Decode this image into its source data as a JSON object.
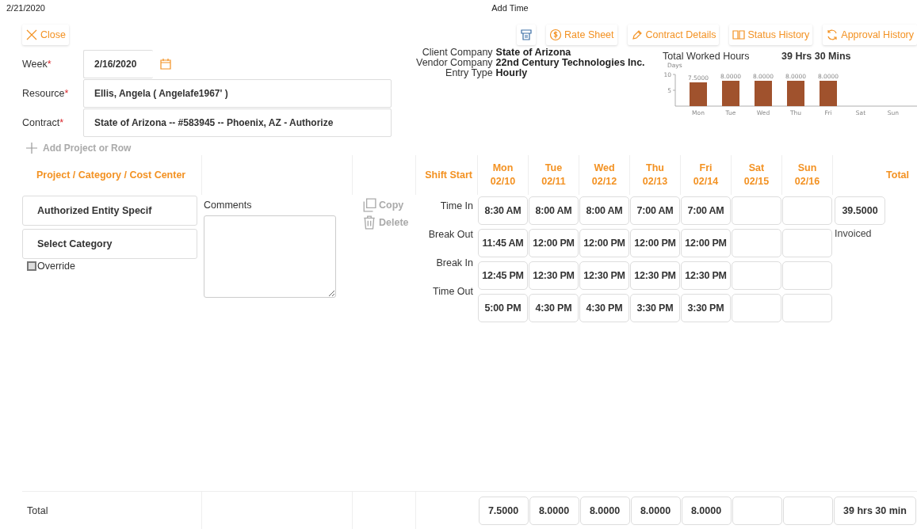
{
  "header": {
    "date": "2/21/2020",
    "title": "Add Time"
  },
  "close_button": {
    "label": "Close"
  },
  "toolbar": [
    {
      "kind": "printer"
    },
    {
      "kind": "dollar",
      "label": "Rate Sheet"
    },
    {
      "kind": "pen",
      "label": "Contract Details"
    },
    {
      "kind": "book",
      "label": "Status History"
    },
    {
      "kind": "refresh",
      "label": "Approval History"
    }
  ],
  "form": [
    {
      "label": "Week",
      "required_mark": "*",
      "value": "2/16/2020",
      "kind": "date"
    },
    {
      "label": "Resource",
      "required_mark": "*",
      "value": "Ellis, Angela ( Angelafe1967' )",
      "kind": "text"
    },
    {
      "label": "Contract",
      "required_mark": "*",
      "value": "State of Arizona -- #583945 -- Phoenix, AZ - Authorize",
      "kind": "text"
    }
  ],
  "add_row": {
    "label": "Add Project or Row"
  },
  "info": [
    {
      "label": "Client Company",
      "value": "State of Arizona"
    },
    {
      "label": "Vendor Company",
      "value": "22nd Century Technologies Inc."
    },
    {
      "label": "Entry Type",
      "value": "Hourly"
    }
  ],
  "hours_summary": {
    "label": "Total Worked Hours",
    "value": "39 Hrs 30 Mins",
    "chart_data": {
      "type": "bar",
      "ylabel": "Days",
      "categories": [
        "Mon",
        "Tue",
        "Wed",
        "Thu",
        "Fri",
        "Sat",
        "Sun"
      ],
      "series": [
        {
          "color": "#a0522d",
          "values": [
            7.5,
            8,
            8,
            8,
            8,
            null,
            null
          ]
        }
      ],
      "ylim": [
        0,
        10
      ],
      "yticks": [
        5,
        10
      ],
      "value_labels": [
        "7.5000",
        "8.0000",
        "8.0000",
        "8.0000",
        "8.0000"
      ]
    }
  },
  "grid": {
    "project_header": "Project / Category / Cost Center",
    "shift_header": "Shift Start",
    "total_header": "Total",
    "days": [
      {
        "day": "Mon",
        "date": "02/10"
      },
      {
        "day": "Tue",
        "date": "02/11"
      },
      {
        "day": "Wed",
        "date": "02/12"
      },
      {
        "day": "Thu",
        "date": "02/13"
      },
      {
        "day": "Fri",
        "date": "02/14"
      },
      {
        "day": "Sat",
        "date": "02/15"
      },
      {
        "day": "Sun",
        "date": "02/16"
      }
    ]
  },
  "entry": {
    "project": "Authorized Entity Specif",
    "category": "Select Category",
    "override": {
      "label": "Override",
      "checked": false
    },
    "comments_label": "Comments",
    "actions": [
      {
        "kind": "copy",
        "label": "Copy",
        "disabled": true
      },
      {
        "kind": "delete",
        "label": "Delete",
        "disabled": true
      }
    ],
    "shift_labels": [
      "Time In",
      "Break Out",
      "Break In",
      "Time Out"
    ],
    "times": [
      [
        "8:30 AM",
        "8:00 AM",
        "8:00 AM",
        "7:00 AM",
        "7:00 AM"
      ],
      [
        "11:45 AM",
        "12:00 PM",
        "12:00 PM",
        "12:00 PM",
        "12:00 PM"
      ],
      [
        "12:45 PM",
        "12:30 PM",
        "12:30 PM",
        "12:30 PM",
        "12:30 PM"
      ],
      [
        "5:00 PM",
        "4:30 PM",
        "4:30 PM",
        "3:30 PM",
        "3:30 PM"
      ]
    ],
    "total": "39.5000",
    "status": "Invoiced"
  },
  "footer": {
    "label": "Total",
    "day_totals": [
      "7.5000",
      "8.0000",
      "8.0000",
      "8.0000",
      "8.0000"
    ],
    "total": "39 hrs 30 min"
  }
}
